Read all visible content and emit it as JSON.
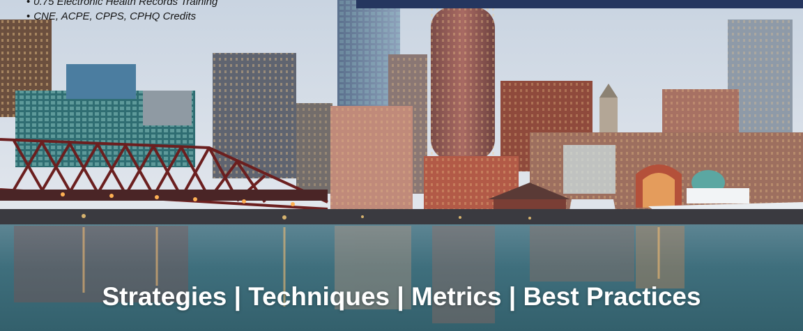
{
  "bullets": [
    "0.75 Electronic Health Records Training",
    "CNE, ACPE, CPPS, CPHQ Credits"
  ],
  "tagline": "Strategies | Techniques | Metrics | Best Practices",
  "colors": {
    "banner": "#25365f",
    "sky_top": "#c8d4e2",
    "water": "#3c6b7a",
    "tagline": "#ffffff"
  }
}
